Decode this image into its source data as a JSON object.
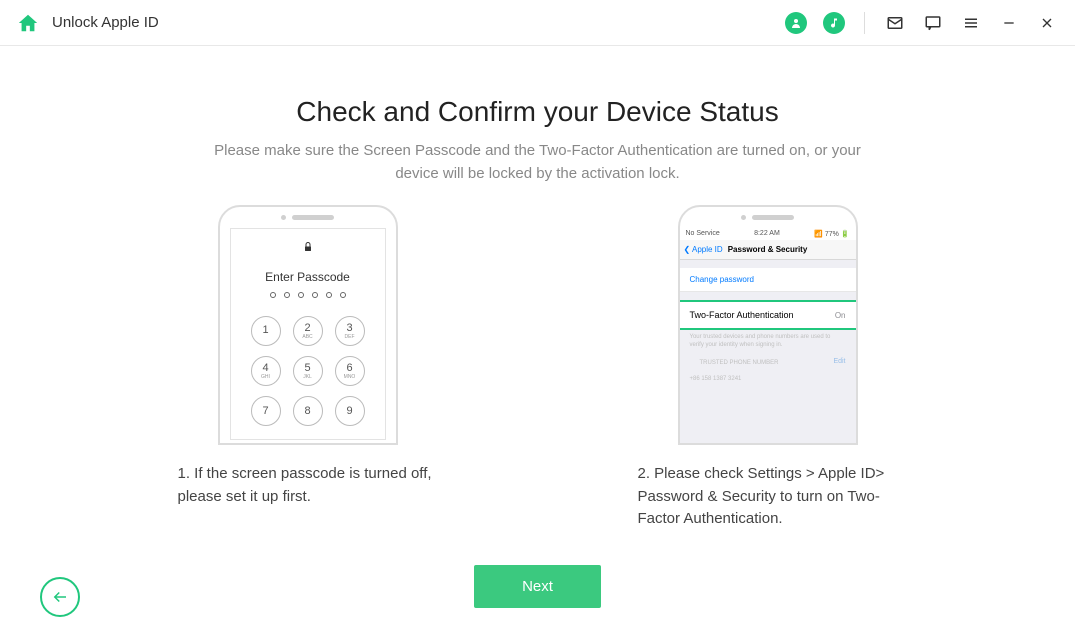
{
  "header": {
    "title": "Unlock Apple ID"
  },
  "main": {
    "title": "Check and Confirm your Device Status",
    "subtitle": "Please make sure the Screen Passcode and the Two-Factor Authentication are turned on, or your device will be locked by the activation lock."
  },
  "phone1": {
    "passcode_label": "Enter Passcode",
    "keys": [
      {
        "n": "1",
        "s": ""
      },
      {
        "n": "2",
        "s": "ABC"
      },
      {
        "n": "3",
        "s": "DEF"
      },
      {
        "n": "4",
        "s": "GHI"
      },
      {
        "n": "5",
        "s": "JKL"
      },
      {
        "n": "6",
        "s": "MNO"
      },
      {
        "n": "7",
        "s": ""
      },
      {
        "n": "8",
        "s": ""
      },
      {
        "n": "9",
        "s": ""
      }
    ]
  },
  "phone2": {
    "status_left": "No Service",
    "status_center": "8:22 AM",
    "status_right": "77%",
    "nav_back": "Apple ID",
    "nav_title": "Password & Security",
    "change_password": "Change password",
    "tfa_label": "Two-Factor Authentication",
    "tfa_status": "On",
    "desc": "Your trusted devices and phone numbers are used to verify your identity when signing in.",
    "trusted_header": "TRUSTED PHONE NUMBER",
    "edit": "Edit",
    "phone_num": "+86 158 1387 3241"
  },
  "steps": {
    "one": "1. If the screen passcode is turned off, please set it up first.",
    "two": "2. Please check Settings > Apple ID> Password & Security to turn on Two-Factor Authentication."
  },
  "buttons": {
    "next": "Next"
  }
}
